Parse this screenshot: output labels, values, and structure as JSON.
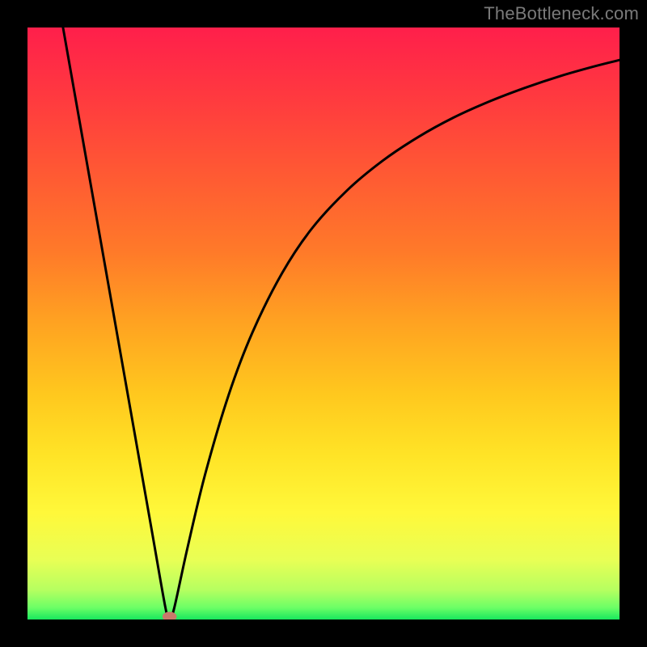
{
  "watermark": "TheBottleneck.com",
  "colors": {
    "frame": "#000000",
    "curve": "#000000",
    "marker": "#c97a6a",
    "gradient_stops": [
      {
        "offset": 0.0,
        "hex": "#ff1f4b"
      },
      {
        "offset": 0.12,
        "hex": "#ff3a3f"
      },
      {
        "offset": 0.25,
        "hex": "#ff5a33"
      },
      {
        "offset": 0.38,
        "hex": "#ff7a29"
      },
      {
        "offset": 0.5,
        "hex": "#ffa321"
      },
      {
        "offset": 0.62,
        "hex": "#ffc81e"
      },
      {
        "offset": 0.72,
        "hex": "#ffe326"
      },
      {
        "offset": 0.82,
        "hex": "#fff83a"
      },
      {
        "offset": 0.9,
        "hex": "#e8ff55"
      },
      {
        "offset": 0.95,
        "hex": "#b6ff60"
      },
      {
        "offset": 0.98,
        "hex": "#6cff66"
      },
      {
        "offset": 1.0,
        "hex": "#18e85e"
      }
    ]
  },
  "chart_data": {
    "type": "line",
    "title": "",
    "xlabel": "",
    "ylabel": "",
    "xlim": [
      0,
      1
    ],
    "ylim": [
      0,
      1
    ],
    "grid": false,
    "legend_position": "none",
    "marker": {
      "x": 0.24,
      "y": 0.005,
      "rx": 0.012,
      "ry": 0.008
    },
    "series": [
      {
        "name": "curve",
        "x": [
          0.06,
          0.09,
          0.12,
          0.15,
          0.18,
          0.21,
          0.233,
          0.24,
          0.248,
          0.27,
          0.3,
          0.34,
          0.38,
          0.43,
          0.48,
          0.54,
          0.6,
          0.66,
          0.72,
          0.78,
          0.84,
          0.9,
          0.96,
          1.0
        ],
        "y": [
          1.0,
          0.83,
          0.66,
          0.49,
          0.32,
          0.15,
          0.02,
          0.0,
          0.02,
          0.12,
          0.245,
          0.38,
          0.485,
          0.585,
          0.66,
          0.725,
          0.775,
          0.815,
          0.848,
          0.875,
          0.898,
          0.918,
          0.935,
          0.945
        ]
      }
    ]
  }
}
